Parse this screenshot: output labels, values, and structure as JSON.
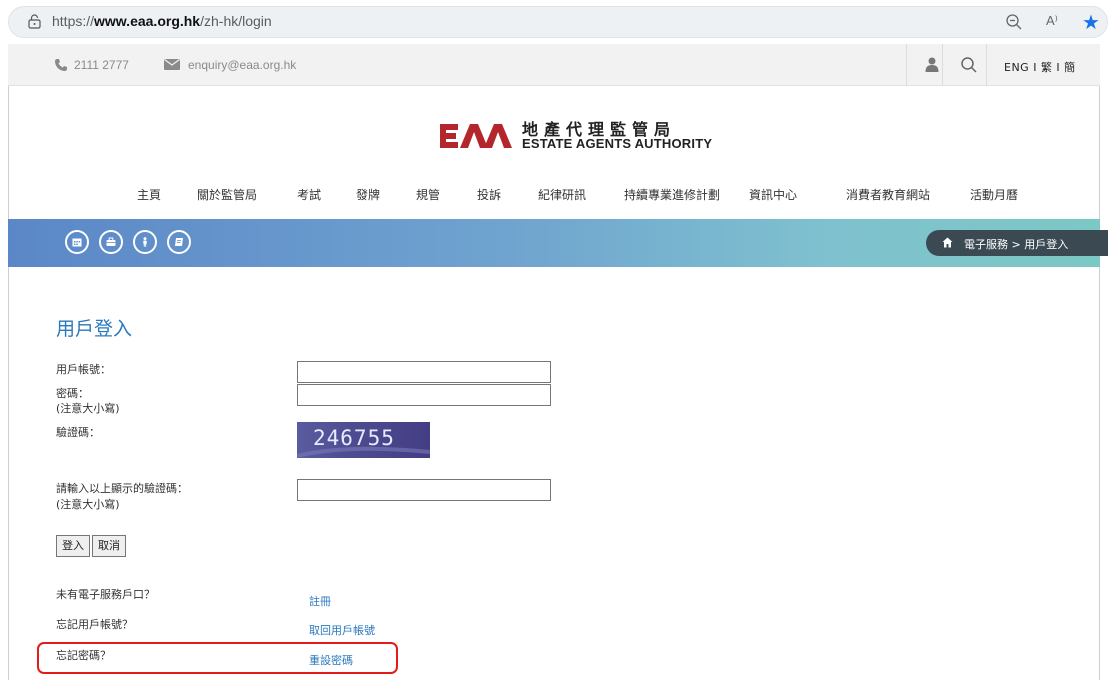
{
  "browser": {
    "url_prefix": "https://",
    "url_domain": "www.eaa.org.hk",
    "url_path": "/zh-hk/login",
    "read_aloud_label": "A⁾"
  },
  "topbar": {
    "phone": "2111 2777",
    "email": "enquiry@eaa.org.hk",
    "lang": "ENG I 繁 I 簡"
  },
  "logo": {
    "chinese": "地產代理監管局",
    "english": "ESTATE AGENTS AUTHORITY"
  },
  "nav": {
    "items": [
      "主頁",
      "關於監管局",
      "考試",
      "發牌",
      "規管",
      "投訴",
      "紀律研訊",
      "持續專業進修計劃",
      "資訊中心",
      "消費者教育網站",
      "活動月曆"
    ]
  },
  "breadcrumb": {
    "section": "電子服務",
    "separator": ">",
    "current": "用戶登入"
  },
  "form": {
    "title": "用戶登入",
    "username_label": "用戶帳號：",
    "password_label": "密碼：",
    "password_note": "(注意大小寫)",
    "captcha_label": "驗證碼：",
    "captcha_value": "246755",
    "captcha_input_label": "請輸入以上顯示的驗證碼：",
    "captcha_input_note": "(注意大小寫)",
    "username_value": "",
    "password_value": "",
    "captcha_input_value": "",
    "login_button": "登入",
    "cancel_button": "取消"
  },
  "links": {
    "no_account_q": "未有電子服務戶口？",
    "register": "註冊",
    "forgot_user_q": "忘記用戶帳號？",
    "retrieve_user": "取回用戶帳號",
    "forgot_pw_q": "忘記密碼？",
    "reset_pw": "重設密碼"
  },
  "colors": {
    "link": "#2a79bd",
    "logo_red": "#b3262b",
    "highlight": "#e31b1b"
  }
}
